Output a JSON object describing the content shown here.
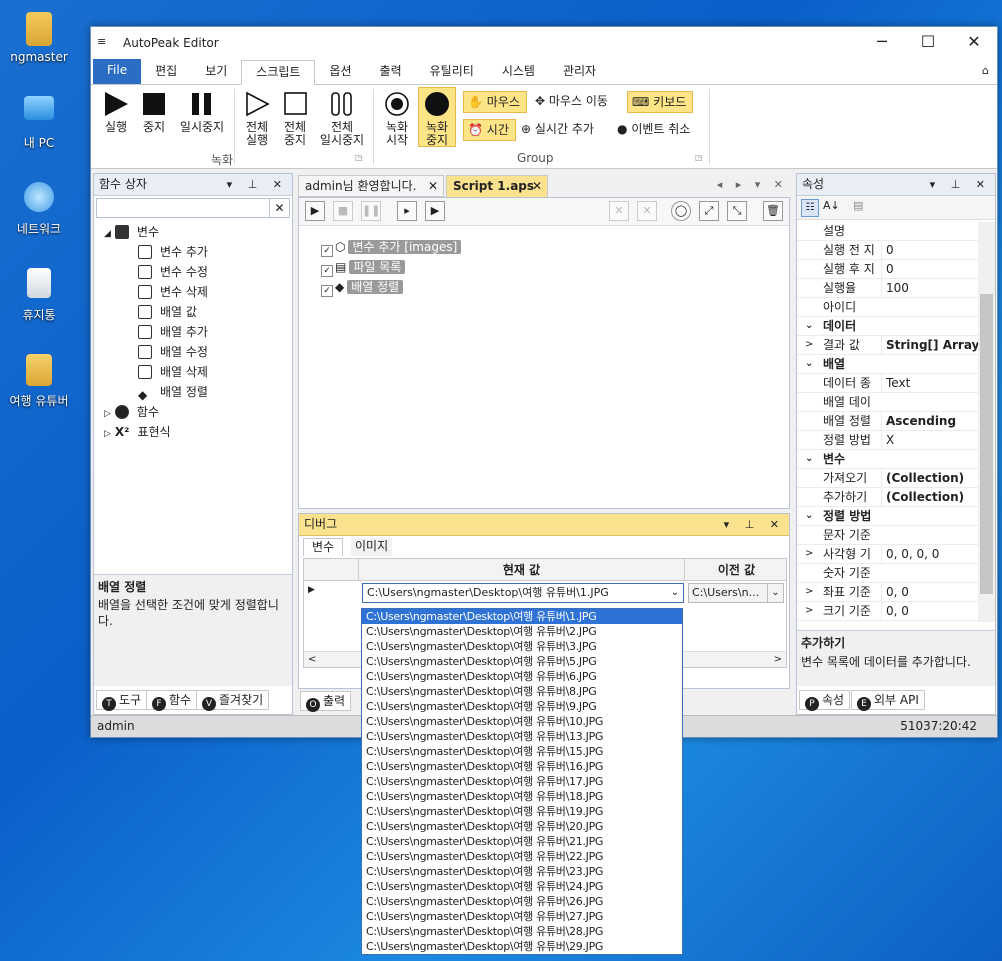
{
  "desktop": {
    "icons": [
      {
        "label": "ngmaster",
        "icon": "user-folder-icon"
      },
      {
        "label": "내 PC",
        "icon": "pc-icon"
      },
      {
        "label": "네트워크",
        "icon": "network-icon"
      },
      {
        "label": "휴지통",
        "icon": "recycle-bin-icon"
      },
      {
        "label": "여행 유튜버",
        "icon": "folder-icon"
      }
    ]
  },
  "window": {
    "title": "AutoPeak Editor",
    "controls": [
      "─",
      "☐",
      "✕"
    ]
  },
  "ribbon_tabs": [
    "File",
    "편집",
    "보기",
    "스크립트",
    "옵션",
    "출력",
    "유틸리티",
    "시스템",
    "관리자"
  ],
  "ribbon": {
    "record_group": {
      "label": "녹화",
      "buttons": [
        {
          "line1": "실행",
          "line2": ""
        },
        {
          "line1": "중지",
          "line2": ""
        },
        {
          "line1": "일시중지",
          "line2": ""
        },
        {
          "line1": "전체",
          "line2": "실행"
        },
        {
          "line1": "전체",
          "line2": "중지"
        },
        {
          "line1": "전체",
          "line2": "일시중지"
        }
      ]
    },
    "group_group": {
      "label": "Group",
      "buttons": [
        {
          "line1": "녹화",
          "line2": "시작"
        },
        {
          "line1": "녹화",
          "line2": "중지"
        }
      ],
      "small": {
        "mouse": "마우스",
        "mouse_move": "마우스 이동",
        "keyboard": "키보드",
        "time": "시간",
        "realtime_add": "실시간 추가",
        "event_cancel": "이벤트 취소"
      }
    }
  },
  "func_box": {
    "title": "함수 상자",
    "search_value": "",
    "tree": [
      {
        "label": "변수",
        "level": 0,
        "expander": "◢"
      },
      {
        "label": "변수 추가",
        "level": 1
      },
      {
        "label": "변수 수정",
        "level": 1
      },
      {
        "label": "변수 삭제",
        "level": 1
      },
      {
        "label": "배열 값",
        "level": 1
      },
      {
        "label": "배열 추가",
        "level": 1
      },
      {
        "label": "배열 수정",
        "level": 1
      },
      {
        "label": "배열 삭제",
        "level": 1
      },
      {
        "label": "배열 정렬",
        "level": 1
      },
      {
        "label": "함수",
        "level": 0,
        "expander": "▷"
      },
      {
        "label": "표현식",
        "level": 0,
        "expander": "▷"
      }
    ],
    "desc_title": "배열 정렬",
    "desc_text": "배열을 선택한 조건에 맞게 정렬합니다.",
    "bottom_tabs": [
      {
        "badge": "T",
        "label": "도구"
      },
      {
        "badge": "F",
        "label": "함수"
      },
      {
        "badge": "V",
        "label": "즐겨찾기"
      }
    ]
  },
  "doc_tabs": [
    {
      "label": "admin님 환영합니다."
    },
    {
      "label": "Script 1.aps"
    }
  ],
  "script_tree": [
    {
      "label": "변수 추가 [images]"
    },
    {
      "label": "파일 목록"
    },
    {
      "label": "배열 정렬"
    }
  ],
  "debug": {
    "title": "디버그",
    "tabs": [
      "변수",
      "이미지"
    ],
    "col_current": "현재 값",
    "col_prev": "이전 값",
    "current_value": "C:\\Users\\ngmaster\\Desktop\\여행 유튜버\\1.JPG",
    "prev_value": "C:\\Users\\n...",
    "bottom_tabs": [
      {
        "badge": "O",
        "label": "출력"
      }
    ],
    "dropdown_items": [
      "C:\\Users\\ngmaster\\Desktop\\여행 유튜버\\1.JPG",
      "C:\\Users\\ngmaster\\Desktop\\여행 유튜버\\2.JPG",
      "C:\\Users\\ngmaster\\Desktop\\여행 유튜버\\3.JPG",
      "C:\\Users\\ngmaster\\Desktop\\여행 유튜버\\5.JPG",
      "C:\\Users\\ngmaster\\Desktop\\여행 유튜버\\6.JPG",
      "C:\\Users\\ngmaster\\Desktop\\여행 유튜버\\8.JPG",
      "C:\\Users\\ngmaster\\Desktop\\여행 유튜버\\9.JPG",
      "C:\\Users\\ngmaster\\Desktop\\여행 유튜버\\10.JPG",
      "C:\\Users\\ngmaster\\Desktop\\여행 유튜버\\13.JPG",
      "C:\\Users\\ngmaster\\Desktop\\여행 유튜버\\15.JPG",
      "C:\\Users\\ngmaster\\Desktop\\여행 유튜버\\16.JPG",
      "C:\\Users\\ngmaster\\Desktop\\여행 유튜버\\17.JPG",
      "C:\\Users\\ngmaster\\Desktop\\여행 유튜버\\18.JPG",
      "C:\\Users\\ngmaster\\Desktop\\여행 유튜버\\19.JPG",
      "C:\\Users\\ngmaster\\Desktop\\여행 유튜버\\20.JPG",
      "C:\\Users\\ngmaster\\Desktop\\여행 유튜버\\21.JPG",
      "C:\\Users\\ngmaster\\Desktop\\여행 유튜버\\22.JPG",
      "C:\\Users\\ngmaster\\Desktop\\여행 유튜버\\23.JPG",
      "C:\\Users\\ngmaster\\Desktop\\여행 유튜버\\24.JPG",
      "C:\\Users\\ngmaster\\Desktop\\여행 유튜버\\26.JPG",
      "C:\\Users\\ngmaster\\Desktop\\여행 유튜버\\27.JPG",
      "C:\\Users\\ngmaster\\Desktop\\여행 유튜버\\28.JPG",
      "C:\\Users\\ngmaster\\Desktop\\여행 유튜버\\29.JPG"
    ]
  },
  "properties": {
    "title": "속성",
    "rows": [
      {
        "type": "prop",
        "name": "설명",
        "value": ""
      },
      {
        "type": "prop",
        "name": "실행 전 지",
        "value": "0"
      },
      {
        "type": "prop",
        "name": "실행 후 지",
        "value": "0"
      },
      {
        "type": "prop",
        "name": "실행율",
        "value": "100"
      },
      {
        "type": "prop",
        "name": "아이디",
        "value": ""
      },
      {
        "type": "cat",
        "name": "데이터",
        "value": ""
      },
      {
        "type": "prop",
        "name": "결과 값",
        "value": "String[] Array",
        "bold": true,
        "expander": ">"
      },
      {
        "type": "cat",
        "name": "배열",
        "value": ""
      },
      {
        "type": "prop",
        "name": "데이터 종",
        "value": "Text"
      },
      {
        "type": "prop",
        "name": "배열 데이",
        "value": ""
      },
      {
        "type": "prop",
        "name": "배열 정렬",
        "value": "Ascending",
        "bold": true
      },
      {
        "type": "prop",
        "name": "정렬 방법",
        "value": "X"
      },
      {
        "type": "cat",
        "name": "변수",
        "value": ""
      },
      {
        "type": "prop",
        "name": "가져오기",
        "value": "(Collection)",
        "bold": true
      },
      {
        "type": "prop",
        "name": "추가하기",
        "value": "(Collection)",
        "bold": true
      },
      {
        "type": "cat",
        "name": "정렬 방법",
        "value": ""
      },
      {
        "type": "prop",
        "name": "문자 기준",
        "value": ""
      },
      {
        "type": "prop",
        "name": "사각형 기",
        "value": "0, 0, 0, 0",
        "expander": ">"
      },
      {
        "type": "prop",
        "name": "숫자 기준",
        "value": ""
      },
      {
        "type": "prop",
        "name": "좌표 기준",
        "value": "0, 0",
        "expander": ">"
      },
      {
        "type": "prop",
        "name": "크기 기준",
        "value": "0, 0",
        "expander": ">"
      }
    ],
    "desc_title": "추가하기",
    "desc_text": "변수 목록에 데이터를 추가합니다.",
    "bottom_tabs": [
      {
        "badge": "P",
        "label": "속성"
      },
      {
        "badge": "E",
        "label": "외부 API"
      }
    ]
  },
  "statusbar": {
    "user": "admin",
    "time": "51037:20:42"
  }
}
